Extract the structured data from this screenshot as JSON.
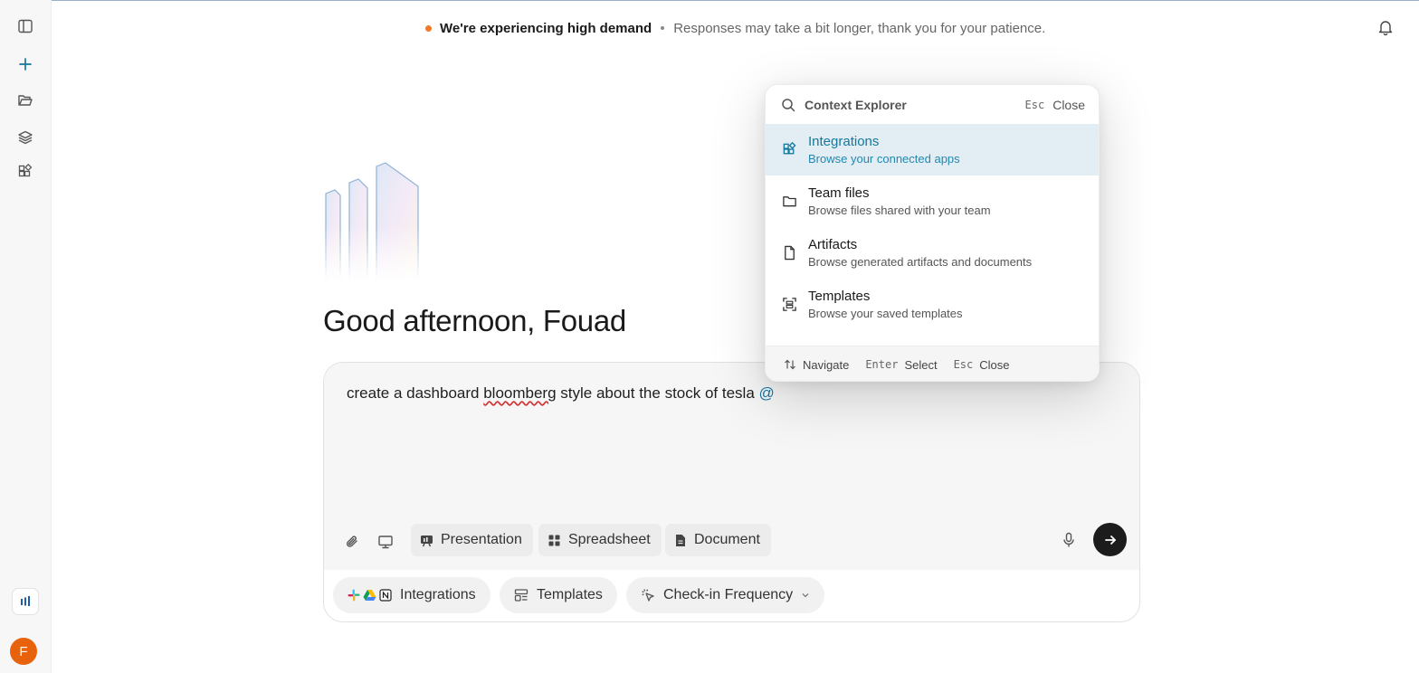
{
  "banner": {
    "headline": "We're experiencing high demand",
    "message": "Responses may take a bit longer, thank you for your patience."
  },
  "sidebar": {
    "items": [
      {
        "name": "sidebar-toggle",
        "icon": "panel-left-icon"
      },
      {
        "name": "new-chat",
        "icon": "plus-icon"
      },
      {
        "name": "projects",
        "icon": "folder-open-icon"
      },
      {
        "name": "layers",
        "icon": "layers-icon"
      },
      {
        "name": "integrations",
        "icon": "apps-icon"
      }
    ],
    "avatar_initial": "F"
  },
  "greeting": "Good afternoon, Fouad",
  "composer": {
    "text_before": "create a dashboard ",
    "text_misspelled": "bloomberg",
    "text_after": " style about the stock of tesla ",
    "mention_trigger": "@",
    "modes": [
      {
        "label": "Presentation",
        "icon": "presentation-icon"
      },
      {
        "label": "Spreadsheet",
        "icon": "spreadsheet-icon"
      },
      {
        "label": "Document",
        "icon": "document-icon"
      }
    ],
    "bottom_pills": {
      "integrations": "Integrations",
      "templates": "Templates",
      "checkin": "Check-in Frequency"
    }
  },
  "context_explorer": {
    "placeholder": "Context Explorer",
    "esc_key": "Esc",
    "close_label": "Close",
    "items": [
      {
        "title": "Integrations",
        "subtitle": "Browse your connected apps",
        "icon": "apps-icon",
        "active": true
      },
      {
        "title": "Team files",
        "subtitle": "Browse files shared with your team",
        "icon": "folder-icon",
        "active": false
      },
      {
        "title": "Artifacts",
        "subtitle": "Browse generated artifacts and documents",
        "icon": "file-icon",
        "active": false
      },
      {
        "title": "Templates",
        "subtitle": "Browse your saved templates",
        "icon": "template-scan-icon",
        "active": false
      }
    ],
    "footer": {
      "navigate_label": "Navigate",
      "enter_key": "Enter",
      "select_label": "Select",
      "esc_key": "Esc",
      "close_label": "Close"
    }
  },
  "colors": {
    "accent": "#14789e",
    "active_row": "#e2eef4",
    "banner_dot": "#f07a2a",
    "avatar": "#e8620c",
    "send_button": "#1c1c1c"
  }
}
